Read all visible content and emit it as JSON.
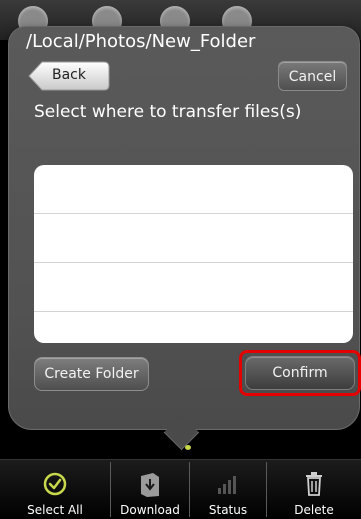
{
  "dialog": {
    "path_title": "/Local/Photos/New_Folder",
    "back_label": "Back",
    "cancel_label": "Cancel",
    "instruction": "Select where to transfer files(s)",
    "folder_list_rows": 4,
    "create_folder_label": "Create Folder",
    "confirm_label": "Confirm",
    "highlight_color": "#e50000"
  },
  "toolbar": {
    "items": [
      {
        "label": "Select All",
        "icon": "checkmark-circle-icon",
        "color": "#c8d84c"
      },
      {
        "label": "Download",
        "icon": "download-icon",
        "color": "#9a9a9a"
      },
      {
        "label": "Status",
        "icon": "signal-bars-icon",
        "color": "#555555"
      },
      {
        "label": "Delete",
        "icon": "trash-icon",
        "color": "#cfcfcf"
      }
    ]
  }
}
